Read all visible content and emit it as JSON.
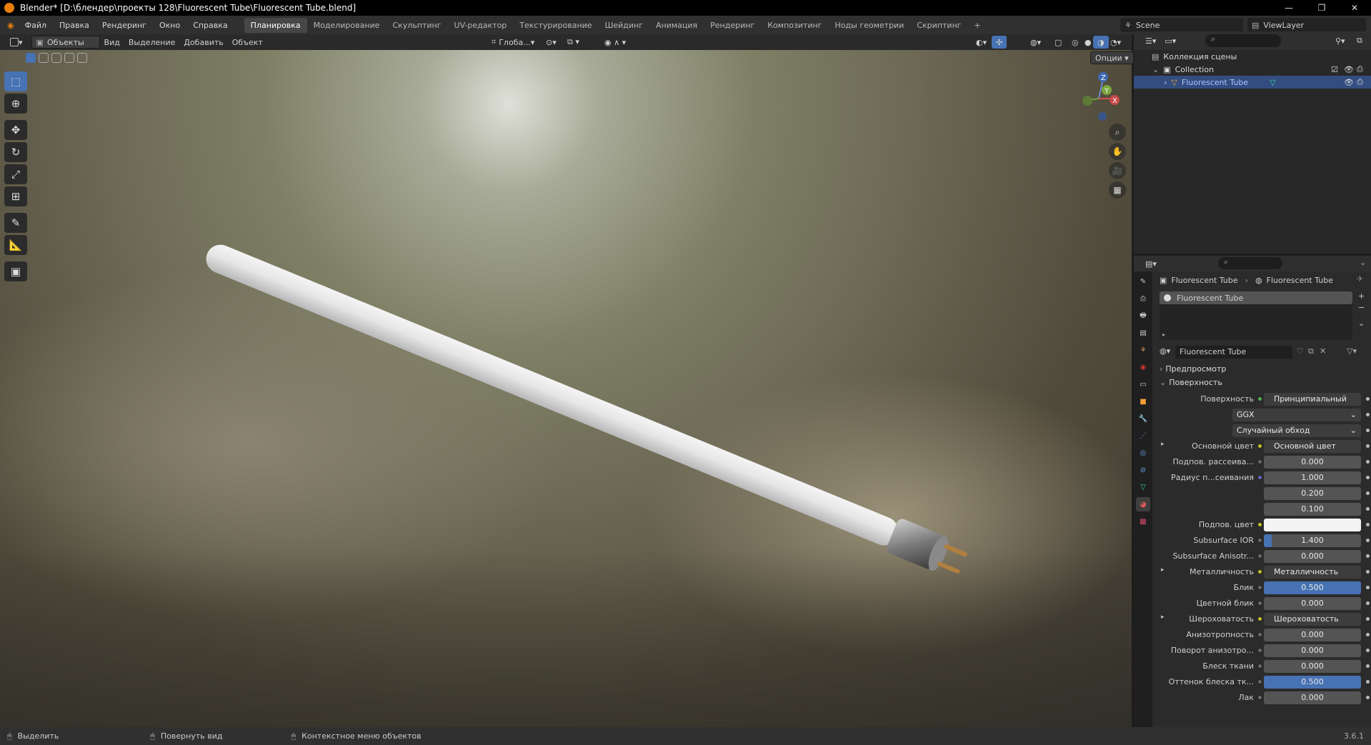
{
  "window": {
    "title": "Blender* [D:\\блендер\\проекты 128\\Fluorescent Tube\\Fluorescent Tube.blend]",
    "controls": [
      "—",
      "❐",
      "✕"
    ]
  },
  "menu": {
    "items": [
      "Файл",
      "Правка",
      "Рендеринг",
      "Окно",
      "Справка"
    ]
  },
  "workspaces": {
    "tabs": [
      "Планировка",
      "Моделирование",
      "Скульптинг",
      "UV-редактор",
      "Текстурирование",
      "Шейдинг",
      "Анимация",
      "Рендеринг",
      "Композитинг",
      "Ноды геометрии",
      "Скриптинг"
    ],
    "add": "+"
  },
  "scene": {
    "name": "Scene",
    "view_layer": "ViewLayer"
  },
  "header3d": {
    "mode": "Объекты",
    "view": "Вид",
    "select": "Выделение",
    "add": "Добавить",
    "object": "Объект",
    "orientation": "Глоба...",
    "options": "Опции"
  },
  "gizmo": {
    "z": "Z",
    "y": "Y",
    "x": "X"
  },
  "outliner": {
    "scene_collection": "Коллекция сцены",
    "collection": "Collection",
    "object": "Fluorescent Tube"
  },
  "properties": {
    "breadcrumb_object": "Fluorescent Tube",
    "breadcrumb_material": "Fluorescent Tube",
    "slot": "Fluorescent Tube",
    "material_name": "Fluorescent Tube",
    "preview_panel": "Предпросмотр",
    "surface_panel": "Поверхность",
    "rows": [
      {
        "label": "Поверхность",
        "value": "Принципиальный BSDF",
        "dot": "g",
        "type": "dark"
      },
      {
        "label": "",
        "value": "GGX",
        "type": "dd"
      },
      {
        "label": "",
        "value": "Случайный обход",
        "type": "dd"
      },
      {
        "label": "Основной цвет",
        "value": "Основной цвет",
        "dot": "y",
        "type": "dark",
        "expand": "▸"
      },
      {
        "label": "Подпов. рассеива...",
        "value": "0.000",
        "dot": "n"
      },
      {
        "label": "Радиус п...сеивания",
        "value": "1.000",
        "dot": "b"
      },
      {
        "label": "",
        "value": "0.200"
      },
      {
        "label": "",
        "value": "0.100"
      },
      {
        "label": "Подпов. цвет",
        "value": "",
        "dot": "y",
        "type": "white"
      },
      {
        "label": "Subsurface IOR",
        "value": "1.400",
        "dot": "n",
        "fill": 0.1
      },
      {
        "label": "Subsurface Anisotr...",
        "value": "0.000",
        "dot": "n"
      },
      {
        "label": "Металличность",
        "value": "Металличность",
        "dot": "y",
        "type": "dark",
        "expand": "▸"
      },
      {
        "label": "Блик",
        "value": "0.500",
        "dot": "n",
        "fill": 1.0
      },
      {
        "label": "Цветной блик",
        "value": "0.000",
        "dot": "n"
      },
      {
        "label": "Шероховатость",
        "value": "Шероховатость",
        "dot": "y",
        "type": "dark",
        "expand": "▸"
      },
      {
        "label": "Анизотропность",
        "value": "0.000",
        "dot": "n"
      },
      {
        "label": "Поворот анизотро...",
        "value": "0.000",
        "dot": "n"
      },
      {
        "label": "Блеск ткани",
        "value": "0.000",
        "dot": "n"
      },
      {
        "label": "Оттенок блеска тк...",
        "value": "0.500",
        "dot": "n",
        "fill": 1.0
      },
      {
        "label": "Лак",
        "value": "0.000",
        "dot": "n"
      }
    ]
  },
  "statusbar": {
    "select": "Выделить",
    "rotate": "Повернуть вид",
    "context": "Контекстное меню объектов",
    "version": "3.6.1"
  }
}
